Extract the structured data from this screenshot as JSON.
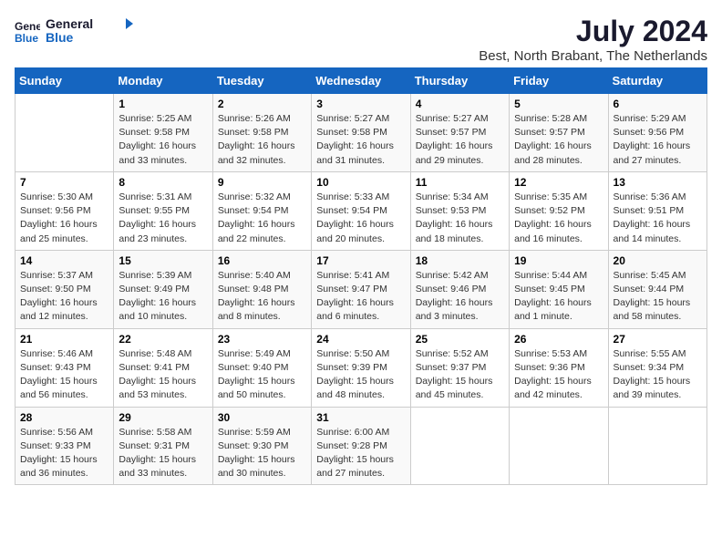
{
  "logo": {
    "line1": "General",
    "line2": "Blue"
  },
  "title": "July 2024",
  "location": "Best, North Brabant, The Netherlands",
  "days_of_week": [
    "Sunday",
    "Monday",
    "Tuesday",
    "Wednesday",
    "Thursday",
    "Friday",
    "Saturday"
  ],
  "weeks": [
    [
      {
        "day": "",
        "info": ""
      },
      {
        "day": "1",
        "info": "Sunrise: 5:25 AM\nSunset: 9:58 PM\nDaylight: 16 hours\nand 33 minutes."
      },
      {
        "day": "2",
        "info": "Sunrise: 5:26 AM\nSunset: 9:58 PM\nDaylight: 16 hours\nand 32 minutes."
      },
      {
        "day": "3",
        "info": "Sunrise: 5:27 AM\nSunset: 9:58 PM\nDaylight: 16 hours\nand 31 minutes."
      },
      {
        "day": "4",
        "info": "Sunrise: 5:27 AM\nSunset: 9:57 PM\nDaylight: 16 hours\nand 29 minutes."
      },
      {
        "day": "5",
        "info": "Sunrise: 5:28 AM\nSunset: 9:57 PM\nDaylight: 16 hours\nand 28 minutes."
      },
      {
        "day": "6",
        "info": "Sunrise: 5:29 AM\nSunset: 9:56 PM\nDaylight: 16 hours\nand 27 minutes."
      }
    ],
    [
      {
        "day": "7",
        "info": "Sunrise: 5:30 AM\nSunset: 9:56 PM\nDaylight: 16 hours\nand 25 minutes."
      },
      {
        "day": "8",
        "info": "Sunrise: 5:31 AM\nSunset: 9:55 PM\nDaylight: 16 hours\nand 23 minutes."
      },
      {
        "day": "9",
        "info": "Sunrise: 5:32 AM\nSunset: 9:54 PM\nDaylight: 16 hours\nand 22 minutes."
      },
      {
        "day": "10",
        "info": "Sunrise: 5:33 AM\nSunset: 9:54 PM\nDaylight: 16 hours\nand 20 minutes."
      },
      {
        "day": "11",
        "info": "Sunrise: 5:34 AM\nSunset: 9:53 PM\nDaylight: 16 hours\nand 18 minutes."
      },
      {
        "day": "12",
        "info": "Sunrise: 5:35 AM\nSunset: 9:52 PM\nDaylight: 16 hours\nand 16 minutes."
      },
      {
        "day": "13",
        "info": "Sunrise: 5:36 AM\nSunset: 9:51 PM\nDaylight: 16 hours\nand 14 minutes."
      }
    ],
    [
      {
        "day": "14",
        "info": "Sunrise: 5:37 AM\nSunset: 9:50 PM\nDaylight: 16 hours\nand 12 minutes."
      },
      {
        "day": "15",
        "info": "Sunrise: 5:39 AM\nSunset: 9:49 PM\nDaylight: 16 hours\nand 10 minutes."
      },
      {
        "day": "16",
        "info": "Sunrise: 5:40 AM\nSunset: 9:48 PM\nDaylight: 16 hours\nand 8 minutes."
      },
      {
        "day": "17",
        "info": "Sunrise: 5:41 AM\nSunset: 9:47 PM\nDaylight: 16 hours\nand 6 minutes."
      },
      {
        "day": "18",
        "info": "Sunrise: 5:42 AM\nSunset: 9:46 PM\nDaylight: 16 hours\nand 3 minutes."
      },
      {
        "day": "19",
        "info": "Sunrise: 5:44 AM\nSunset: 9:45 PM\nDaylight: 16 hours\nand 1 minute."
      },
      {
        "day": "20",
        "info": "Sunrise: 5:45 AM\nSunset: 9:44 PM\nDaylight: 15 hours\nand 58 minutes."
      }
    ],
    [
      {
        "day": "21",
        "info": "Sunrise: 5:46 AM\nSunset: 9:43 PM\nDaylight: 15 hours\nand 56 minutes."
      },
      {
        "day": "22",
        "info": "Sunrise: 5:48 AM\nSunset: 9:41 PM\nDaylight: 15 hours\nand 53 minutes."
      },
      {
        "day": "23",
        "info": "Sunrise: 5:49 AM\nSunset: 9:40 PM\nDaylight: 15 hours\nand 50 minutes."
      },
      {
        "day": "24",
        "info": "Sunrise: 5:50 AM\nSunset: 9:39 PM\nDaylight: 15 hours\nand 48 minutes."
      },
      {
        "day": "25",
        "info": "Sunrise: 5:52 AM\nSunset: 9:37 PM\nDaylight: 15 hours\nand 45 minutes."
      },
      {
        "day": "26",
        "info": "Sunrise: 5:53 AM\nSunset: 9:36 PM\nDaylight: 15 hours\nand 42 minutes."
      },
      {
        "day": "27",
        "info": "Sunrise: 5:55 AM\nSunset: 9:34 PM\nDaylight: 15 hours\nand 39 minutes."
      }
    ],
    [
      {
        "day": "28",
        "info": "Sunrise: 5:56 AM\nSunset: 9:33 PM\nDaylight: 15 hours\nand 36 minutes."
      },
      {
        "day": "29",
        "info": "Sunrise: 5:58 AM\nSunset: 9:31 PM\nDaylight: 15 hours\nand 33 minutes."
      },
      {
        "day": "30",
        "info": "Sunrise: 5:59 AM\nSunset: 9:30 PM\nDaylight: 15 hours\nand 30 minutes."
      },
      {
        "day": "31",
        "info": "Sunrise: 6:00 AM\nSunset: 9:28 PM\nDaylight: 15 hours\nand 27 minutes."
      },
      {
        "day": "",
        "info": ""
      },
      {
        "day": "",
        "info": ""
      },
      {
        "day": "",
        "info": ""
      }
    ]
  ]
}
